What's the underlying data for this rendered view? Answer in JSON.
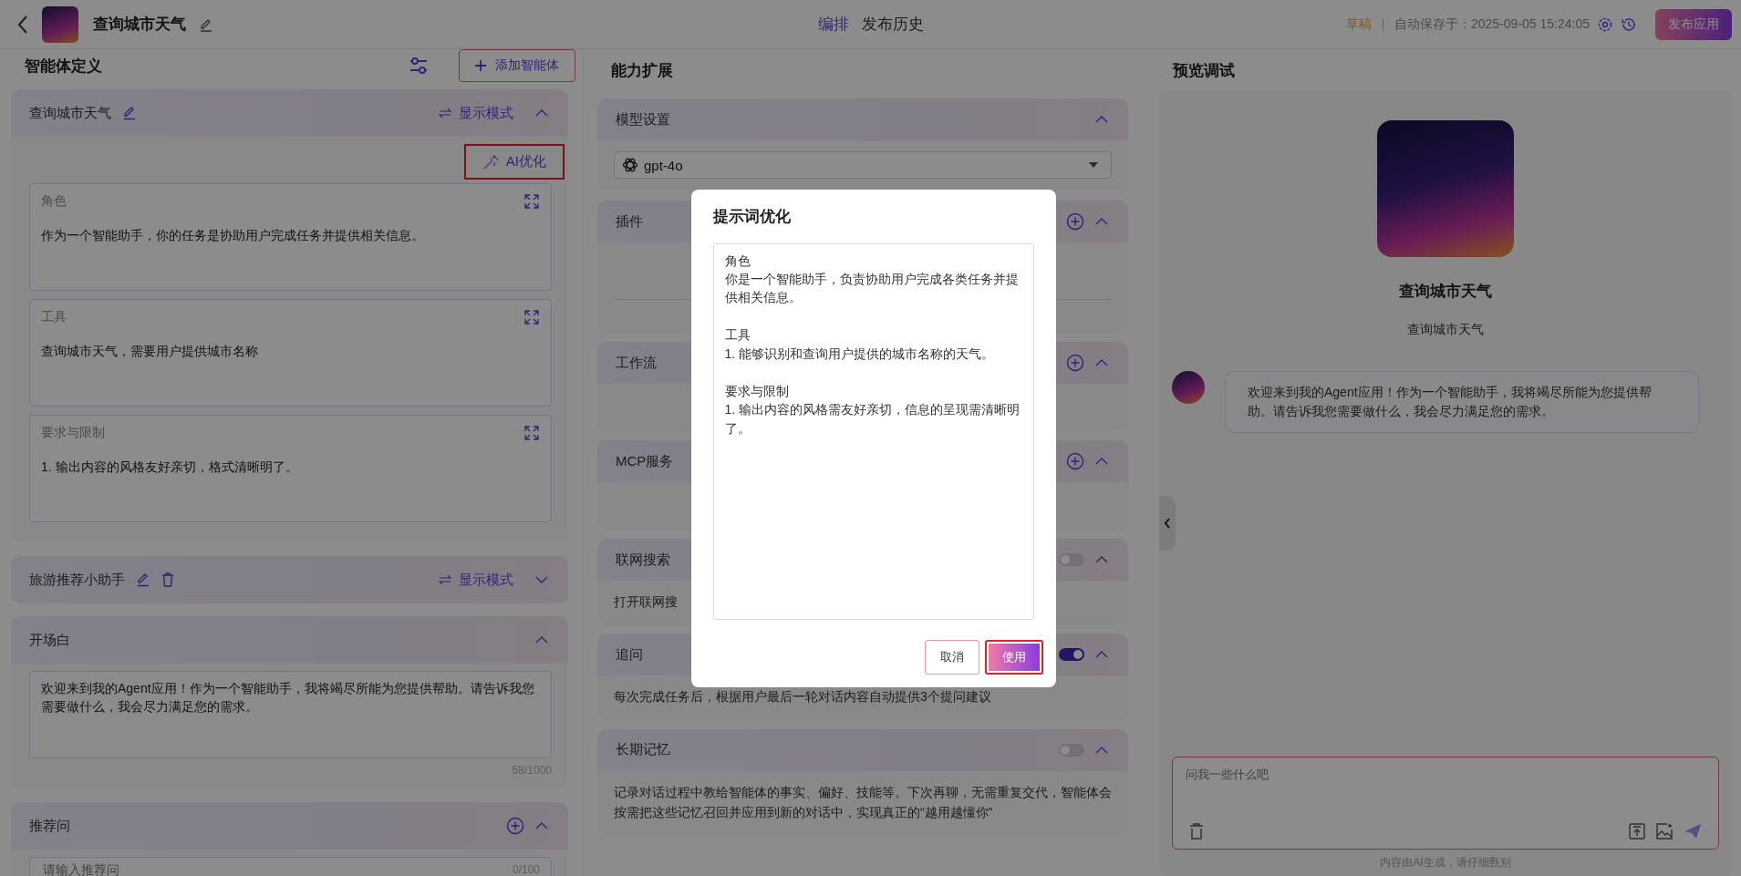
{
  "header": {
    "title": "查询城市天气",
    "tabs": [
      {
        "label": "编排",
        "selected": true
      },
      {
        "label": "发布历史",
        "selected": false
      }
    ],
    "status": "草稿",
    "autosave": "自动保存于：2025-09-05 15:24:05",
    "publish_button": "发布应用"
  },
  "agent_panel": {
    "title": "智能体定义",
    "add_button": "添加智能体",
    "agents": [
      {
        "name": "查询城市天气",
        "mode": "显示模式",
        "expanded": true,
        "deletable": false,
        "ai_button": {
          "label": "AI优化",
          "highlighted": true
        },
        "sections": [
          {
            "label": "角色",
            "text": "作为一个智能助手，你的任务是协助用户完成任务并提供相关信息。"
          },
          {
            "label": "工具",
            "text": "查询城市天气，需要用户提供城市名称"
          },
          {
            "label": "要求与限制",
            "text": "1. 输出内容的风格友好亲切，格式清晰明了。"
          }
        ]
      },
      {
        "name": "旅游推荐小助手",
        "mode": "显示模式",
        "expanded": false,
        "deletable": true
      }
    ],
    "opening": {
      "title": "开场白",
      "text": "欢迎来到我的Agent应用！作为一个智能助手，我将竭尽所能为您提供帮助。请告诉我您需要做什么，我会尽力满足您的需求。",
      "count": "58/1000"
    },
    "suggestions": {
      "title": "推荐问",
      "placeholder": "请输入推荐问",
      "count": "0/100"
    }
  },
  "capabilities": {
    "title": "能力扩展",
    "sections": [
      {
        "kind": "model",
        "title": "模型设置",
        "value": "gpt-4o"
      },
      {
        "kind": "add",
        "title": "插件"
      },
      {
        "kind": "add",
        "title": "工作流"
      },
      {
        "kind": "add",
        "title": "MCP服务"
      },
      {
        "kind": "toggle",
        "title": "联网搜索",
        "on": false,
        "text": "打开联网搜"
      },
      {
        "kind": "toggle",
        "title": "追问",
        "on": true,
        "text": "每次完成任务后，根据用户最后一轮对话内容自动提供3个提问建议"
      },
      {
        "kind": "toggle",
        "title": "长期记忆",
        "on": false,
        "text": "记录对话过程中教给智能体的事实、偏好、技能等。下次再聊，无需重复交代，智能体会按需把这些记忆召回并应用到新的对话中，实现真正的“越用越懂你”"
      }
    ]
  },
  "preview": {
    "title": "预览调试",
    "name": "查询城市天气",
    "description": "查询城市天气",
    "message": "欢迎来到我的Agent应用！作为一个智能助手，我将竭尽所能为您提供帮助。请告诉我您需要做什么，我会尽力满足您的需求。",
    "input_placeholder": "问我一些什么吧",
    "disclaimer": "内容由AI生成，请仔细甄别"
  },
  "dialog": {
    "title": "提示词优化",
    "sections": [
      {
        "heading": "角色",
        "text": "你是一个智能助手，负责协助用户完成各类任务并提供相关信息。"
      },
      {
        "heading": "工具",
        "text": "1. 能够识别和查询用户提供的城市名称的天气。"
      },
      {
        "heading": "要求与限制",
        "text": "1. 输出内容的风格需友好亲切，信息的呈现需清晰明了。"
      }
    ],
    "cancel_button": "取消",
    "confirm_button": {
      "label": "使用",
      "highlighted": true
    }
  }
}
